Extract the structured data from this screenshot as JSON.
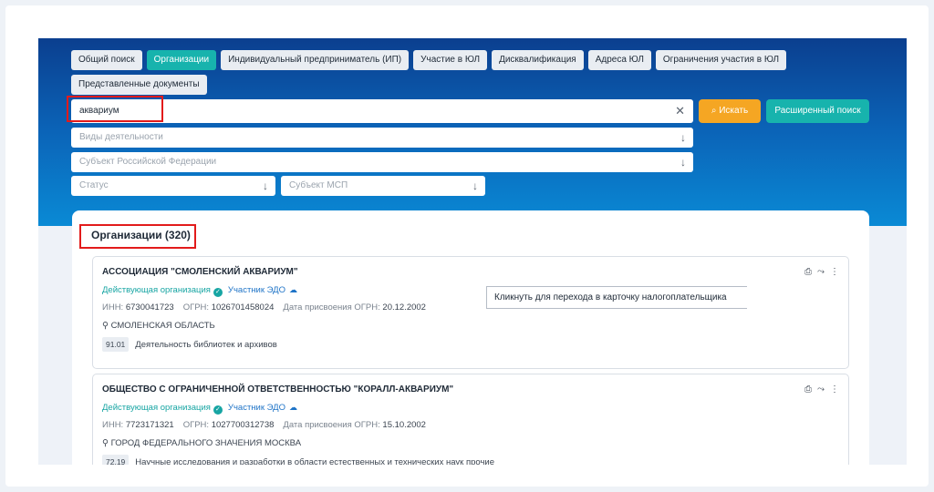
{
  "tabs": [
    "Общий поиск",
    "Организации",
    "Индивидуальный предприниматель (ИП)",
    "Участие в ЮЛ",
    "Дисквалификация",
    "Адреса ЮЛ",
    "Ограничения участия в ЮЛ",
    "Представленные документы"
  ],
  "active_tab": "Организации",
  "search": {
    "value": "аквариум",
    "find_label": "Искать",
    "advanced_label": "Расширенный поиск"
  },
  "filters": {
    "activity": "Виды деятельности",
    "region": "Субъект Российской Федерации",
    "status": "Статус",
    "msp": "Субъект МСП"
  },
  "results": {
    "heading": "Организации (320)",
    "items": [
      {
        "name": "АССОЦИАЦИЯ \"СМОЛЕНСКИЙ АКВАРИУМ\"",
        "status": "Действующая организация",
        "edo": "Участник ЭДО",
        "inn_label": "ИНН:",
        "inn": "6730041723",
        "ogrn_label": "ОГРН:",
        "ogrn": "1026701458024",
        "date_label": "Дата присвоения ОГРН:",
        "date": "20.12.2002",
        "region": "СМОЛЕНСКАЯ ОБЛАСТЬ",
        "okved_code": "91.01",
        "okved_text": "Деятельность библиотек и архивов"
      },
      {
        "name": "ОБЩЕСТВО С ОГРАНИЧЕННОЙ ОТВЕТСТВЕННОСТЬЮ \"КОРАЛЛ-АКВАРИУМ\"",
        "status": "Действующая организация",
        "edo": "Участник ЭДО",
        "inn_label": "ИНН:",
        "inn": "7723171321",
        "ogrn_label": "ОГРН:",
        "ogrn": "1027700312738",
        "date_label": "Дата присвоения ОГРН:",
        "date": "15.10.2002",
        "region": "ГОРОД ФЕДЕРАЛЬНОГО ЗНАЧЕНИЯ МОСКВА",
        "okved_code": "72.19",
        "okved_text": "Научные исследования и разработки в области естественных и технических наук прочие"
      }
    ]
  },
  "tooltip": "Кликнуть для перехода в карточку налогоплательщика",
  "colors": {
    "accent": "#17b3ad",
    "find_button": "#f5a623",
    "highlight": "#e21b1b",
    "hero_top": "#0b3f8f",
    "hero_bottom": "#0a8ad5"
  }
}
